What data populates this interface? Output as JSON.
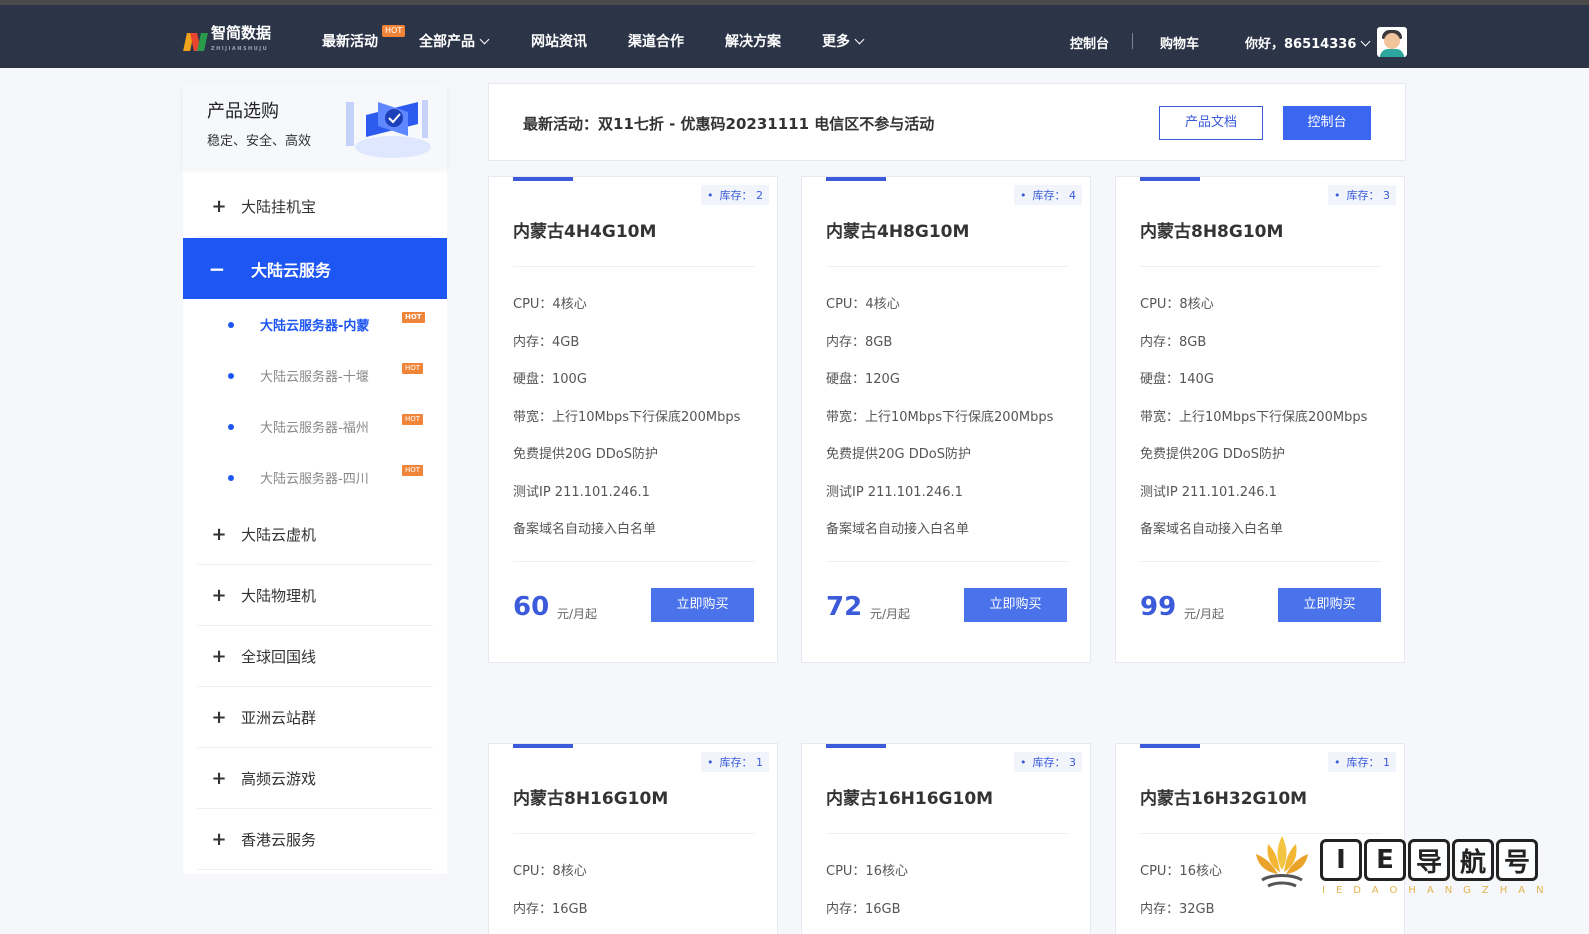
{
  "nav": {
    "logo_text": "智简数据",
    "logo_sub": "ZHIJIANSHUJU",
    "items": [
      {
        "label": "最新活动",
        "badge": "HOT"
      },
      {
        "label": "全部产品"
      },
      {
        "label": "网站资讯"
      },
      {
        "label": "渠道合作"
      },
      {
        "label": "解决方案"
      },
      {
        "label": "更多"
      }
    ],
    "console": "控制台",
    "cart": "购物车",
    "greeting": "你好，86514336"
  },
  "sidebar": {
    "title": "产品选购",
    "subtitle": "稳定、安全、高效",
    "categories_top": [
      {
        "label": "大陆挂机宝"
      }
    ],
    "active": "大陆云服务",
    "sub_items": [
      {
        "label": "大陆云服务器-内蒙",
        "badge": "HOT"
      },
      {
        "label": "大陆云服务器-十堰",
        "badge": "HOT"
      },
      {
        "label": "大陆云服务器-福州",
        "badge": "HOT"
      },
      {
        "label": "大陆云服务器-四川",
        "badge": "HOT"
      }
    ],
    "categories_bottom": [
      {
        "label": "大陆云虚机"
      },
      {
        "label": "大陆物理机"
      },
      {
        "label": "全球回国线"
      },
      {
        "label": "亚洲云站群"
      },
      {
        "label": "高频云游戏"
      },
      {
        "label": "香港云服务"
      }
    ]
  },
  "banner": {
    "text": "最新活动：双11七折 - 优惠码20231111 电信区不参与活动",
    "doc_button": "产品文档",
    "console_button": "控制台"
  },
  "products": [
    {
      "stock": "库存：  2",
      "name": "内蒙古4H4G10M",
      "specs": [
        "CPU：4核心",
        "内存：4GB",
        "硬盘：100G",
        "带宽：上行10Mbps下行保底200Mbps",
        "免费提供20G DDoS防护",
        "测试IP 211.101.246.1",
        "备案域名自动接入白名单"
      ],
      "price": "60",
      "unit": "元/月起",
      "buy": "立即购买"
    },
    {
      "stock": "库存：  4",
      "name": "内蒙古4H8G10M",
      "specs": [
        "CPU：4核心",
        "内存：8GB",
        "硬盘：120G",
        "带宽：上行10Mbps下行保底200Mbps",
        "免费提供20G DDoS防护",
        "测试IP 211.101.246.1",
        "备案域名自动接入白名单"
      ],
      "price": "72",
      "unit": "元/月起",
      "buy": "立即购买"
    },
    {
      "stock": "库存：  3",
      "name": "内蒙古8H8G10M",
      "specs": [
        "CPU：8核心",
        "内存：8GB",
        "硬盘：140G",
        "带宽：上行10Mbps下行保底200Mbps",
        "免费提供20G DDoS防护",
        "测试IP 211.101.246.1",
        "备案域名自动接入白名单"
      ],
      "price": "99",
      "unit": "元/月起",
      "buy": "立即购买"
    },
    {
      "stock": "库存：  1",
      "name": "内蒙古8H16G10M",
      "specs": [
        "CPU：8核心",
        "内存：16GB"
      ]
    },
    {
      "stock": "库存：  3",
      "name": "内蒙古16H16G10M",
      "specs": [
        "CPU：16核心",
        "内存：16GB"
      ]
    },
    {
      "stock": "库存：  1",
      "name": "内蒙古16H32G10M",
      "specs": [
        "CPU：16核心",
        "内存：32GB"
      ]
    }
  ],
  "watermark": {
    "chars": [
      "I",
      "E",
      "导",
      "航",
      "号"
    ],
    "pinyin": "IEDAOHANGZHAN"
  },
  "colors": {
    "accent": "#1d56f3",
    "nav_bg": "#2c3448",
    "price": "#3b5bdb",
    "hot": "#f0853a"
  }
}
